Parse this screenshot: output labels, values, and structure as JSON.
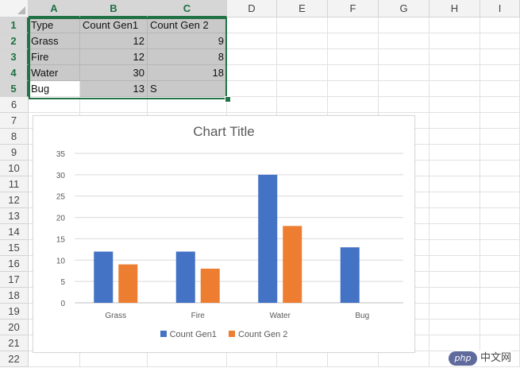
{
  "sheet": {
    "columns": [
      "A",
      "B",
      "C",
      "D",
      "E",
      "F",
      "G",
      "H",
      "I"
    ],
    "rows": [
      "1",
      "2",
      "3",
      "4",
      "5",
      "6",
      "7",
      "8",
      "9",
      "10",
      "11",
      "12",
      "13",
      "14",
      "15",
      "16",
      "17",
      "18",
      "19",
      "20",
      "21",
      "22"
    ],
    "cells": [
      [
        "Type",
        "Count Gen1",
        "Count Gen 2"
      ],
      [
        "Grass",
        "12",
        "9"
      ],
      [
        "Fire",
        "12",
        "8"
      ],
      [
        "Water",
        "30",
        "18"
      ],
      [
        "Bug",
        "13",
        "S"
      ]
    ]
  },
  "chart_data": {
    "type": "bar",
    "title": "Chart Title",
    "categories": [
      "Grass",
      "Fire",
      "Water",
      "Bug"
    ],
    "series": [
      {
        "name": "Count Gen1",
        "values": [
          12,
          12,
          30,
          13
        ],
        "color": "#4472c4"
      },
      {
        "name": "Count Gen 2",
        "values": [
          9,
          8,
          18,
          0
        ],
        "color": "#ed7d31"
      }
    ],
    "ylim": [
      0,
      35
    ],
    "yticks": [
      "0",
      "5",
      "10",
      "15",
      "20",
      "25",
      "30",
      "35"
    ],
    "grid": true,
    "legend": "bottom"
  },
  "watermark": {
    "brand": "php",
    "cn": "中文网"
  }
}
